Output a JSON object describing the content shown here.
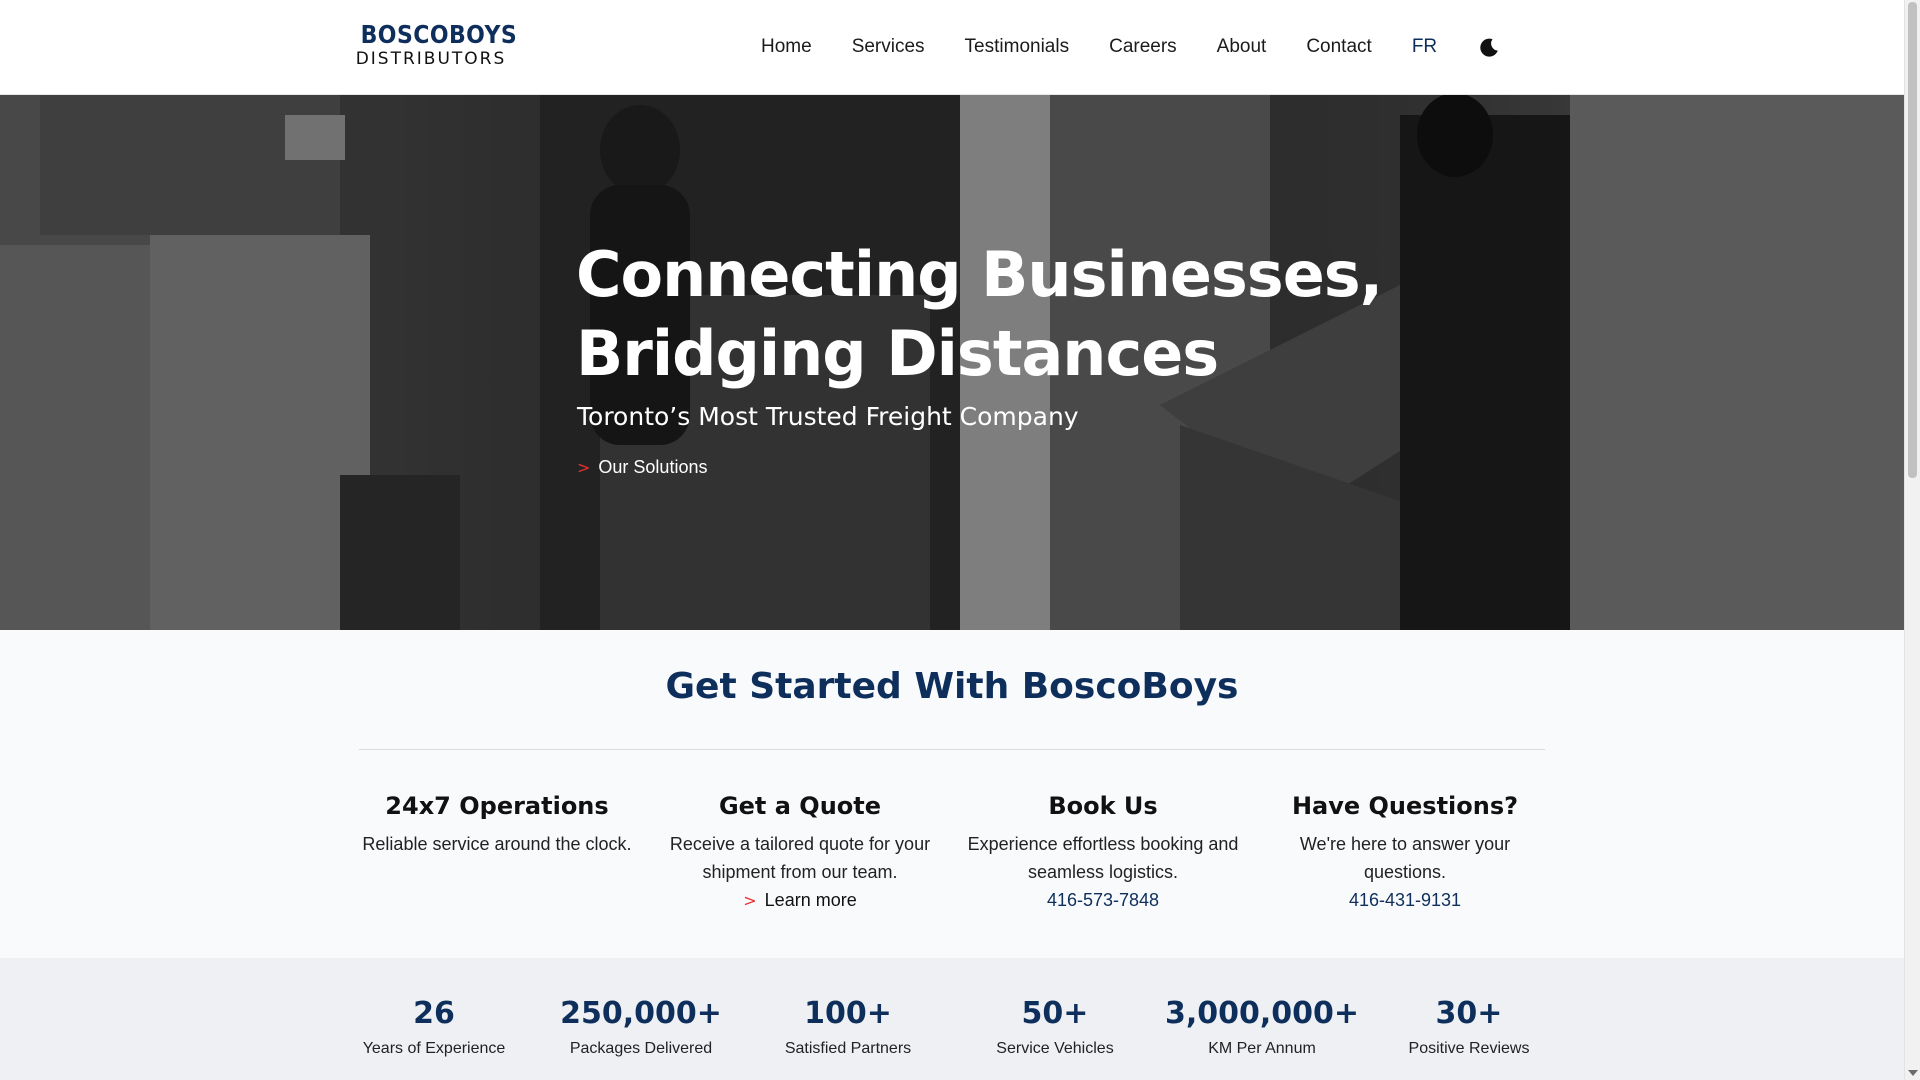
{
  "brand": {
    "name_top": "BOSCOBOYS",
    "name_bottom": "DISTRIBUTORS",
    "primary_color": "#0e2f5c",
    "accent_color": "#e63030"
  },
  "nav": {
    "items": [
      "Home",
      "Services",
      "Testimonials",
      "Careers",
      "About",
      "Contact"
    ],
    "language": "FR",
    "theme_toggle_icon": "moon-icon"
  },
  "hero": {
    "title_line1": "Connecting Businesses,",
    "title_line2": "Bridging Distances",
    "subtitle": "Toronto’s Most Trusted Freight Company",
    "cta": "Our Solutions",
    "cta_icon": ">"
  },
  "get_started": {
    "title": "Get Started With BoscoBoys",
    "cards": [
      {
        "title": "24x7 Operations",
        "text": "Reliable service around the clock."
      },
      {
        "title": "Get a Quote",
        "text": "Receive a tailored quote for your shipment from our team.",
        "link": "Learn more",
        "link_icon": ">"
      },
      {
        "title": "Book Us",
        "text": "Experience effortless booking and seamless logistics.",
        "phone": "416-573-7848"
      },
      {
        "title": "Have Questions?",
        "text": "We're here to answer your questions.",
        "phone": "416-431-9131"
      }
    ]
  },
  "stats": [
    {
      "value": "26",
      "label": "Years of Experience"
    },
    {
      "value": "250,000+",
      "label": "Packages Delivered"
    },
    {
      "value": "100+",
      "label": "Satisfied Partners"
    },
    {
      "value": "50+",
      "label": "Service Vehicles"
    },
    {
      "value": "3,000,000+",
      "label": "KM Per Annum"
    },
    {
      "value": "30+",
      "label": "Positive Reviews"
    }
  ]
}
